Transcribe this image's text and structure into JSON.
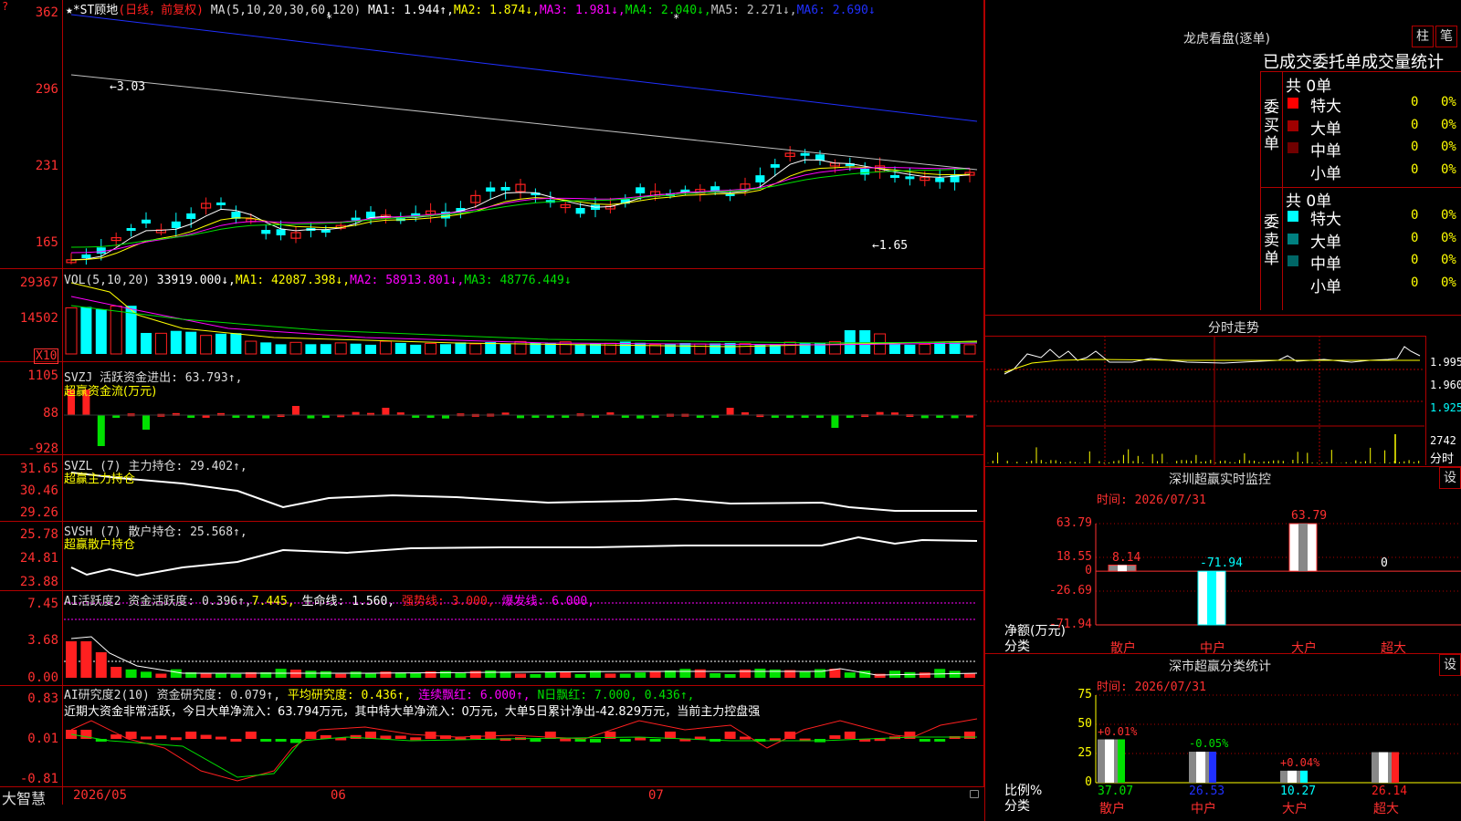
{
  "colors": {
    "up": "#ff2020",
    "down": "#00ffff",
    "ma1": "#ffffff",
    "ma2": "#ffff00",
    "ma3": "#ff00ff",
    "ma4": "#00e000",
    "ma5": "#c0c0c0",
    "ma6": "#2030ff",
    "grid": "#b00000",
    "axis": "#ff3030"
  },
  "main": {
    "title": "★*ST顾地",
    "period": "(日线，前复权)",
    "ma_label": "MA(5,10,20,30,60,120)",
    "ma1": "MA1: 1.944↑,",
    "ma2": "MA2: 1.874↓,",
    "ma3": "MA3: 1.981↓,",
    "ma4": "MA4: 2.040↓,",
    "ma5": "MA5: 2.271↓,",
    "ma6": "MA6: 2.690↓",
    "y_ticks": [
      "362",
      "296",
      "231",
      "165"
    ],
    "high_label": "3.03",
    "low_label": "1.65",
    "corner_mark": "?"
  },
  "vol": {
    "label": "VOL(5,10,20)",
    "value": "33919.000↓,",
    "ma1": "MA1: 42087.398↓,",
    "ma2": "MA2: 58913.801↓,",
    "ma3": "MA3: 48776.449↓",
    "y_ticks": [
      "29367",
      "14502"
    ],
    "unit": "X10"
  },
  "svzj": {
    "label": "SVZJ  活跃资金进出: 63.793↑,",
    "sub": "超赢资金流(万元)",
    "y_ticks": [
      "1105",
      "88",
      "-928"
    ]
  },
  "svzl": {
    "label": "SVZL (7) 主力持仓: 29.402↑,",
    "sub": "超赢主力持仓",
    "y_ticks": [
      "31.65",
      "30.46",
      "29.26"
    ]
  },
  "svsh": {
    "label": "SVSH (7) 散户持仓: 25.568↑,",
    "sub": "超赢散户持仓",
    "y_ticks": [
      "25.78",
      "24.81",
      "23.88"
    ]
  },
  "ai1": {
    "label": "AI活跃度2 资金活跃度: 0.396↑,",
    "v2": "7.445,",
    "life": "生命线: 1.560,",
    "strong": "强势线: 3.000,",
    "burst": "爆发线: 6.000,",
    "y_ticks": [
      "7.45",
      "3.68",
      "0.00"
    ]
  },
  "ai2": {
    "label": "AI研究度2(10) 资金研究度: 0.079↑,",
    "avg": "平均研究度: 0.436↑,",
    "cont": "连续飘红: 6.000↑,",
    "nday": "N日飘红: 7.000, 0.436↑,",
    "comment": "近期大资金非常活跃，今日大单净流入：63.794万元，其中特大单净流入：0万元，大单5日累计净出-42.829万元，当前主力控盘强",
    "y_ticks": [
      "0.83",
      "0.01",
      "-0.81"
    ]
  },
  "xaxis": {
    "brand": "大智慧",
    "dates": [
      "2026/05",
      "06",
      "07"
    ]
  },
  "lhb": {
    "title": "龙虎看盘(逐单)",
    "tab1": "柱",
    "tab2": "笔",
    "subtitle": "已成交委托单成交量统计",
    "buy_label": "委买单",
    "sell_label": "委卖单",
    "buy_total": "共 0单",
    "sell_total": "共 0单",
    "buy_rows": [
      {
        "name": "特大",
        "count": "0",
        "pct": "0%",
        "color": "#ff0000"
      },
      {
        "name": "大单",
        "count": "0",
        "pct": "0%",
        "color": "#a00000"
      },
      {
        "name": "中单",
        "count": "0",
        "pct": "0%",
        "color": "#700000"
      },
      {
        "name": "小单",
        "count": "0",
        "pct": "0%",
        "color": "#000000"
      }
    ],
    "sell_rows": [
      {
        "name": "特大",
        "count": "0",
        "pct": "0%",
        "color": "#00ffff"
      },
      {
        "name": "大单",
        "count": "0",
        "pct": "0%",
        "color": "#008080"
      },
      {
        "name": "中单",
        "count": "0",
        "pct": "0%",
        "color": "#006666"
      },
      {
        "name": "小单",
        "count": "0",
        "pct": "0%",
        "color": "#000000"
      }
    ]
  },
  "intraday": {
    "title": "分时走势",
    "y_ticks": [
      "1.995",
      "1.960",
      "1.925"
    ],
    "vol_tick": "2742",
    "vol_unit": "分时"
  },
  "monitor": {
    "title": "深圳超赢实时监控",
    "set": "设",
    "time": "时间: 2026/07/31",
    "y_ticks": [
      "63.79",
      "18.55",
      "0",
      "-26.69",
      "-71.94"
    ],
    "ylabel": "净额(万元)",
    "xlabel": "分类",
    "cats": [
      "散户",
      "中户",
      "大户",
      "超大"
    ],
    "values": [
      8.14,
      -71.94,
      63.79,
      0
    ],
    "value_labels": [
      "8.14",
      "-71.94",
      "63.79",
      "0"
    ]
  },
  "classify": {
    "title": "深市超赢分类统计",
    "set": "设",
    "time": "时间: 2026/07/31",
    "y_ticks": [
      "75",
      "50",
      "25",
      "0"
    ],
    "ylabel": "比例%",
    "xlabel": "分类",
    "cats": [
      "散户",
      "中户",
      "大户",
      "超大"
    ],
    "values": [
      37.07,
      26.53,
      10.27,
      26.14
    ],
    "deltas": [
      "+0.01%",
      "-0.05%",
      "+0.04%",
      ""
    ]
  }
}
